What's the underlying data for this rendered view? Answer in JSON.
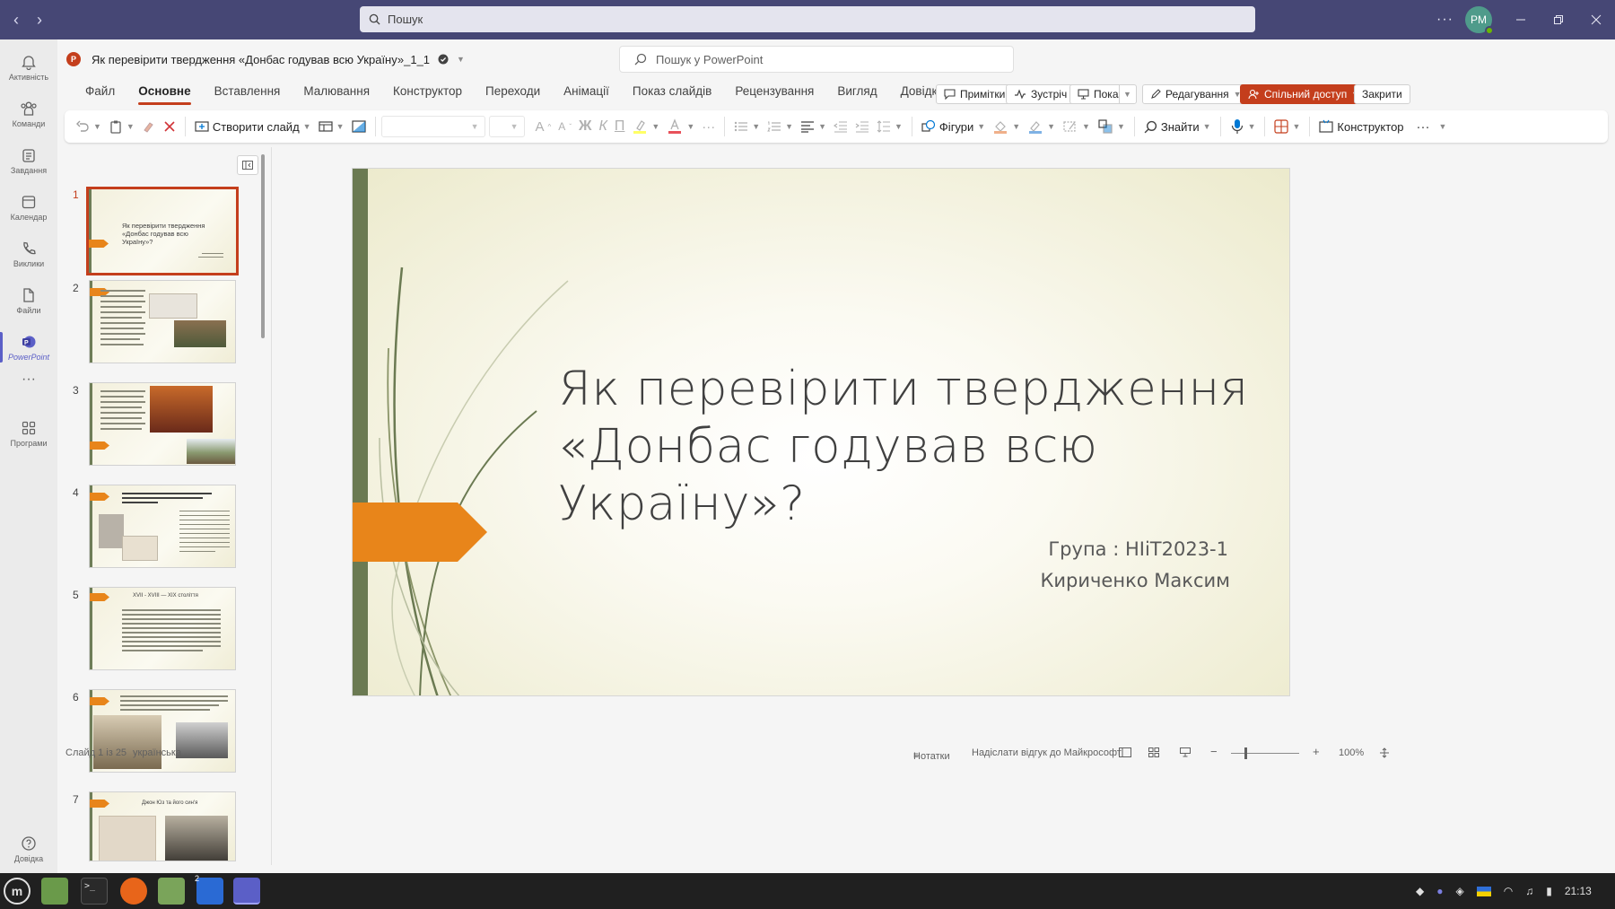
{
  "titlebar": {
    "search_placeholder": "Пошук",
    "avatar_initials": "PM"
  },
  "rail": [
    {
      "label": "Активність",
      "icon": "bell-icon"
    },
    {
      "label": "Команди",
      "icon": "teams-icon"
    },
    {
      "label": "Завдання",
      "icon": "tasks-icon"
    },
    {
      "label": "Календар",
      "icon": "calendar-icon"
    },
    {
      "label": "Виклики",
      "icon": "phone-icon"
    },
    {
      "label": "Файли",
      "icon": "file-icon"
    },
    {
      "label": "PowerPoint",
      "icon": "powerpoint-icon"
    },
    {
      "label": "Програми",
      "icon": "apps-icon"
    },
    {
      "label": "Довідка",
      "icon": "help-icon"
    }
  ],
  "document": {
    "title": "Як перевірити твердження «Донбас годував всю Україну»_1_1",
    "search_placeholder": "Пошук у PowerPoint"
  },
  "menu_tabs": [
    "Файл",
    "Основне",
    "Вставлення",
    "Малювання",
    "Конструктор",
    "Переходи",
    "Анімації",
    "Показ слайдів",
    "Рецензування",
    "Вигляд",
    "Довідка"
  ],
  "active_tab": "Основне",
  "header_buttons": {
    "comments": "Примітки",
    "meet": "Зустріч",
    "present": "Показ",
    "editing": "Редагування",
    "share": "Спільний доступ",
    "close": "Закрити"
  },
  "ribbon": {
    "new_slide": "Створити слайд",
    "bold": "Ж",
    "italic": "К",
    "underline": "П",
    "shapes": "Фігури",
    "find": "Знайти",
    "designer": "Конструктор"
  },
  "slides": {
    "numbers": [
      "1",
      "2",
      "3",
      "4",
      "5",
      "6",
      "7"
    ],
    "thumb1_title": "Як перевірити твердження «Донбас годував всю Україну»?",
    "thumb5_title": "XVII - XVIII — XIX століття",
    "thumb7_title": "Джон Юз та його син'я"
  },
  "current_slide": {
    "title_line1": "Як перевірити твердження",
    "title_line2": "«Донбас годував всю",
    "title_line3": "Україну»?",
    "group": "Група : НІіТ2023-1",
    "author": "Кириченко Максим"
  },
  "status": {
    "slide_count": "Слайд 1 із 25",
    "language": "українська",
    "notes": "Нотатки",
    "feedback": "Надіслати відгук до Майкрософт",
    "zoom": "100%"
  },
  "taskbar": {
    "time": "21:13",
    "badge": "2"
  },
  "colors": {
    "teams_header": "#464775",
    "accent_red": "#c43e1c",
    "slide_green": "#6b7a52",
    "slide_orange": "#e8851a",
    "teams_purple": "#5b5fc7"
  }
}
